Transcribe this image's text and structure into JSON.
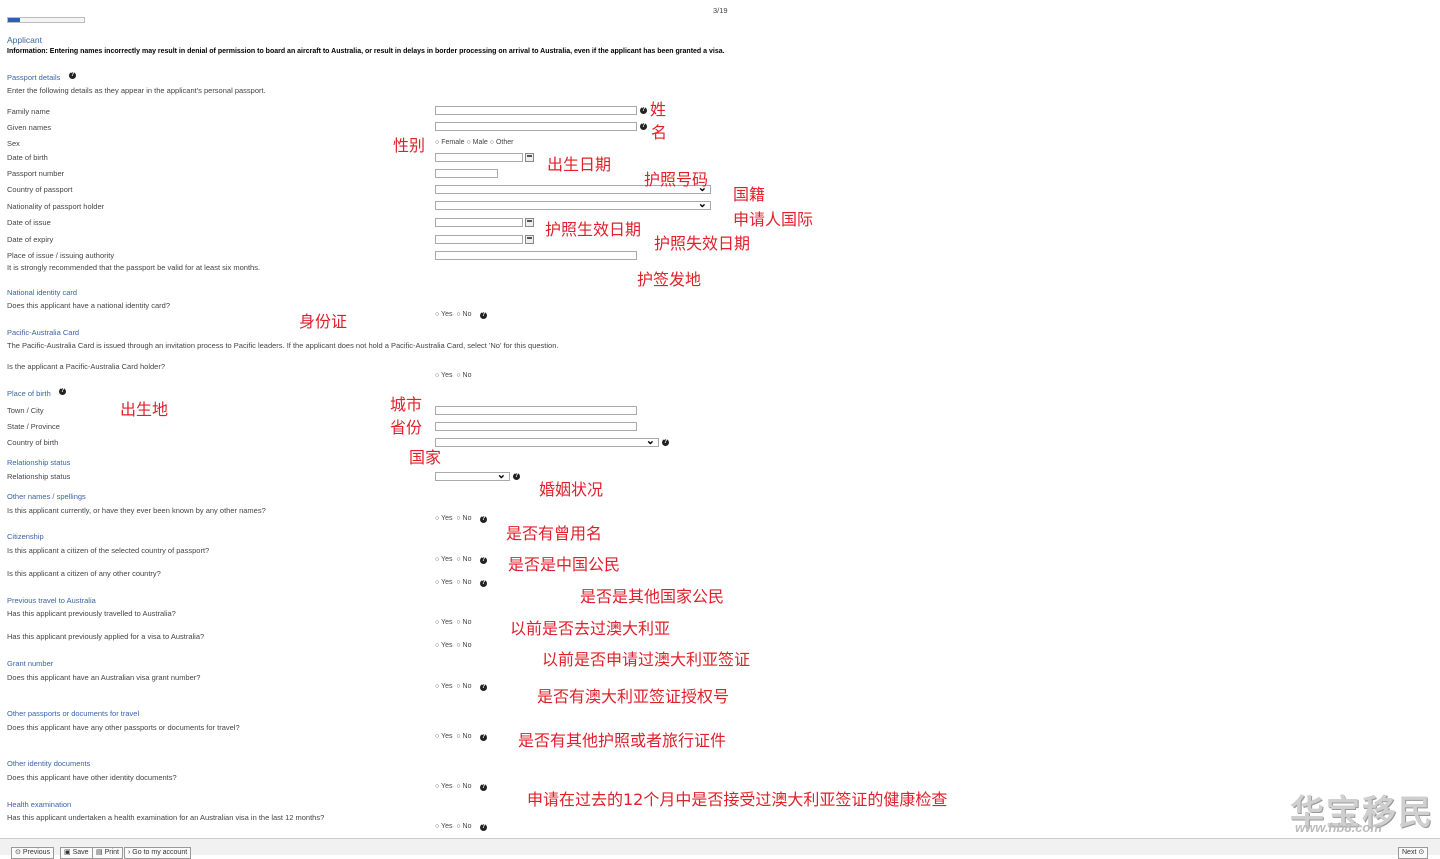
{
  "progress": {
    "text": "3/19",
    "fraction": 0.158
  },
  "header": {
    "title": "Applicant",
    "info": "Information: Entering names incorrectly may result in denial of permission to board an aircraft to Australia, or result in delays in border processing on arrival to Australia, even if the applicant has been granted a visa."
  },
  "passport": {
    "heading": "Passport details",
    "intro": "Enter the following details as they appear in the applicant's personal passport.",
    "family_name": "Family name",
    "given_names": "Given names",
    "sex": "Sex",
    "sex_options": [
      "Female",
      "Male",
      "Other"
    ],
    "dob": "Date of birth",
    "number": "Passport number",
    "country": "Country of passport",
    "nationality": "Nationality of passport holder",
    "issue": "Date of issue",
    "expiry": "Date of expiry",
    "place": "Place of issue / issuing authority",
    "note": "It is strongly recommended that the passport be valid for at least six months."
  },
  "nic": {
    "heading": "National identity card",
    "question": "Does this applicant have a national identity card?"
  },
  "pac": {
    "heading": "Pacific-Australia Card",
    "intro": "The Pacific-Australia Card is issued through an invitation process to Pacific leaders. If the applicant does not hold a Pacific-Australia Card, select 'No' for this question.",
    "question": "Is the applicant a Pacific-Australia Card holder?"
  },
  "pob": {
    "heading": "Place of birth",
    "town": "Town / City",
    "state": "State / Province",
    "country": "Country of birth"
  },
  "rel": {
    "heading": "Relationship status",
    "label": "Relationship status"
  },
  "other_names": {
    "heading": "Other names / spellings",
    "question": "Is this applicant currently, or have they ever been known by any other names?"
  },
  "citizenship": {
    "heading": "Citizenship",
    "q1": "Is this applicant a citizen of the selected country of passport?",
    "q2": "Is this applicant a citizen of any other country?"
  },
  "travel": {
    "heading": "Previous travel to Australia",
    "q1": "Has this applicant previously travelled to Australia?",
    "q2": "Has this applicant previously applied for a visa to Australia?"
  },
  "grant": {
    "heading": "Grant number",
    "question": "Does this applicant have an Australian visa grant number?"
  },
  "other_pass": {
    "heading": "Other passports or documents for travel",
    "question": "Does this applicant have any other passports or documents for travel?"
  },
  "other_id": {
    "heading": "Other identity documents",
    "question": "Does this applicant have other identity documents?"
  },
  "health": {
    "heading": "Health examination",
    "question": "Has this applicant undertaken a health examination for an Australian visa in the last 12 months?"
  },
  "yes": "Yes",
  "no": "No",
  "annotations": {
    "family": "姓",
    "given": "名",
    "sex": "性别",
    "dob": "出生日期",
    "number": "护照号码",
    "country": "国籍",
    "nationality": "申请人国际",
    "issue": "护照生效日期",
    "expiry": "护照失效日期",
    "place": "护签发地",
    "nic": "身份证",
    "pob": "出生地",
    "town": "城市",
    "state": "省份",
    "cob": "国家",
    "rel": "婚姻状况",
    "other_names": "是否有曾用名",
    "cit1": "是否是中国公民",
    "cit2": "是否是其他国家公民",
    "travel1": "以前是否去过澳大利亚",
    "travel2": "以前是否申请过澳大利亚签证",
    "grant": "是否有澳大利亚签证授权号",
    "other_pass": "是否有其他护照或者旅行证件",
    "health": "申请在过去的12个月中是否接受过澳大利亚签证的健康检查"
  },
  "footer": {
    "previous": "Previous",
    "save": "Save",
    "print": "Print",
    "account": "Go to my account",
    "next": "Next"
  },
  "watermark": {
    "main": "华宝移民",
    "url": "www.hb8.com"
  },
  "colors": {
    "heading": "#3a64a8",
    "annotation": "#e0202a",
    "progress": "#2c5fb4"
  }
}
